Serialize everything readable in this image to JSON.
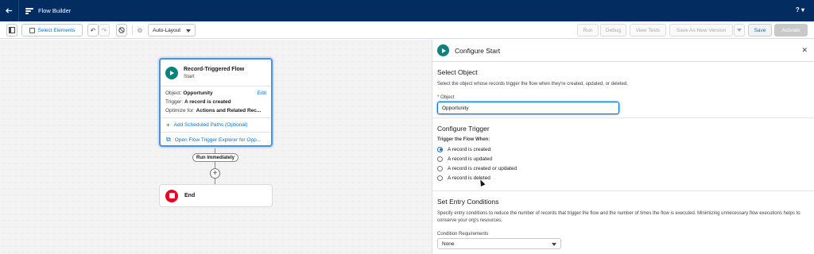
{
  "app": {
    "title": "Flow Builder"
  },
  "toolbar": {
    "select_elements": "Select Elements",
    "layout_value": "Auto-Layout",
    "run": "Run",
    "debug": "Debug",
    "view_tests": "View Tests",
    "save_as_new": "Save As New Version",
    "save": "Save",
    "activate": "Activate"
  },
  "canvas": {
    "start": {
      "title": "Record-Triggered Flow",
      "subtitle": "Start",
      "object_label": "Object:",
      "object_value": "Opportunity",
      "edit": "Edit",
      "trigger_label": "Trigger:",
      "trigger_value": "A record is created",
      "optimize_label": "Optimize for:",
      "optimize_value": "Actions and Related Rec...",
      "add_paths": "Add Scheduled Paths (Optional)",
      "open_explorer": "Open Flow Trigger Explorer for Opp..."
    },
    "run_immediately": "Run Immediately",
    "end_label": "End"
  },
  "panel": {
    "title": "Configure Start",
    "select_object": {
      "heading": "Select Object",
      "desc": "Select the object whose records trigger the flow when they're created, updated, or deleted.",
      "field_label": "Object",
      "field_value": "Opportunity"
    },
    "configure_trigger": {
      "heading": "Configure Trigger",
      "group_label": "Trigger the Flow When:",
      "options": [
        "A record is created",
        "A record is updated",
        "A record is created or updated",
        "A record is deleted"
      ],
      "selected_index": 0
    },
    "entry_conditions": {
      "heading": "Set Entry Conditions",
      "desc": "Specify entry conditions to reduce the number of records that trigger the flow and the number of times the flow is executed. Minimizing unnecessary flow executions helps to conserve your org's resources.",
      "field_label": "Condition Requirements",
      "field_value": "None"
    }
  },
  "colors": {
    "topbar": "#032d60",
    "brand_blue": "#0176d3",
    "start_green": "#0b827c",
    "end_red": "#ea001e"
  },
  "icons": [
    "back-arrow-icon",
    "flow-logo-icon",
    "help-icon",
    "toggle-panel-icon",
    "select-elements-icon",
    "undo-icon",
    "redo-icon",
    "disable-icon",
    "gear-icon",
    "play-icon",
    "plus-icon",
    "end-stop-icon",
    "close-icon",
    "external-link-icon",
    "chevron-down-icon"
  ]
}
